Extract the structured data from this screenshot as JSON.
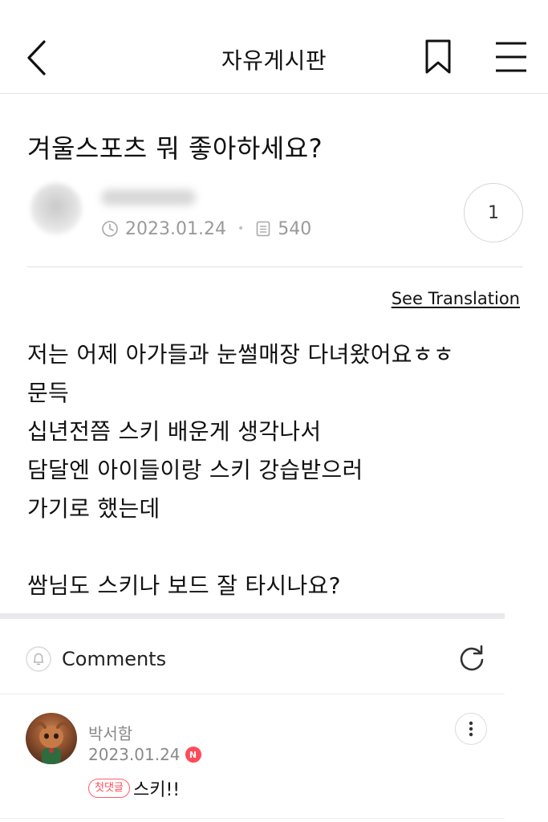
{
  "header": {
    "title": "자유게시판",
    "back_icon": "chevron-left-icon",
    "bookmark_icon": "bookmark-icon",
    "menu_icon": "hamburger-menu-icon"
  },
  "post": {
    "title": "겨울스포츠 뭐 좋아하세요?",
    "date": "2023.01.24",
    "views": "540",
    "comment_count": "1",
    "see_translation": "See Translation",
    "body_lines": [
      "저는 어제 아가들과 눈썰매장 다녀왔어요ㅎㅎ",
      "문득",
      "십년전쯤 스키 배운게 생각나서",
      "담달엔 아이들이랑 스키 강습받으러",
      "가기로 했는데",
      "",
      "쌈님도 스키나 보드 잘 타시나요?"
    ]
  },
  "comments": {
    "label": "Comments",
    "items": [
      {
        "author": "박서함",
        "date": "2023.01.24",
        "new_badge": "N",
        "first_badge": "첫댓글",
        "text": "스키!!"
      }
    ]
  },
  "colors": {
    "accent_red": "#ff4a5a",
    "muted_text": "#9a9a9a",
    "divider": "#e9e9ec"
  }
}
